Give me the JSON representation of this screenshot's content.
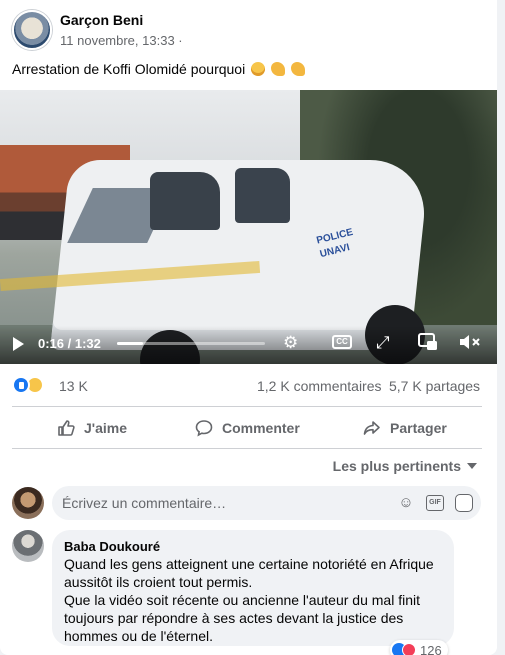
{
  "post": {
    "author": "Garçon Beni",
    "timestamp": "11 novembre, 13:33",
    "separator": "·",
    "text": "Arrestation de Koffi Olomidé pourquoi",
    "emojis": [
      "crying-face",
      "flexed-biceps",
      "flexed-biceps"
    ]
  },
  "video": {
    "current_time": "0:16",
    "duration": "1:32",
    "time_label": "0:16 / 1:32",
    "progress_fraction": 0.174,
    "overlay_text": "POLICE\nUNAVI",
    "cc_label": "CC"
  },
  "stats": {
    "reaction_count": "13 K",
    "comments": "1,2 K commentaires",
    "shares": "5,7 K partages",
    "reaction_types": [
      "like",
      "sad"
    ]
  },
  "actions": {
    "like": "J'aime",
    "comment": "Commenter",
    "share": "Partager"
  },
  "comments": {
    "sort_label": "Les plus pertinents",
    "compose_placeholder": "Écrivez un commentaire…",
    "items": [
      {
        "author": "Baba Doukouré",
        "text": "Quand les gens atteignent une certaine notoriété en Afrique aussitôt ils croient tout permis.\nQue la vidéo soit récente ou ancienne l'auteur du mal finit toujours par répondre à ses actes devant la justice des hommes ou de l'éternel.",
        "reaction_count": "126"
      }
    ]
  },
  "colors": {
    "accent": "#1877f2",
    "muted_text": "#65676b",
    "bubble_bg": "#f0f2f5"
  }
}
